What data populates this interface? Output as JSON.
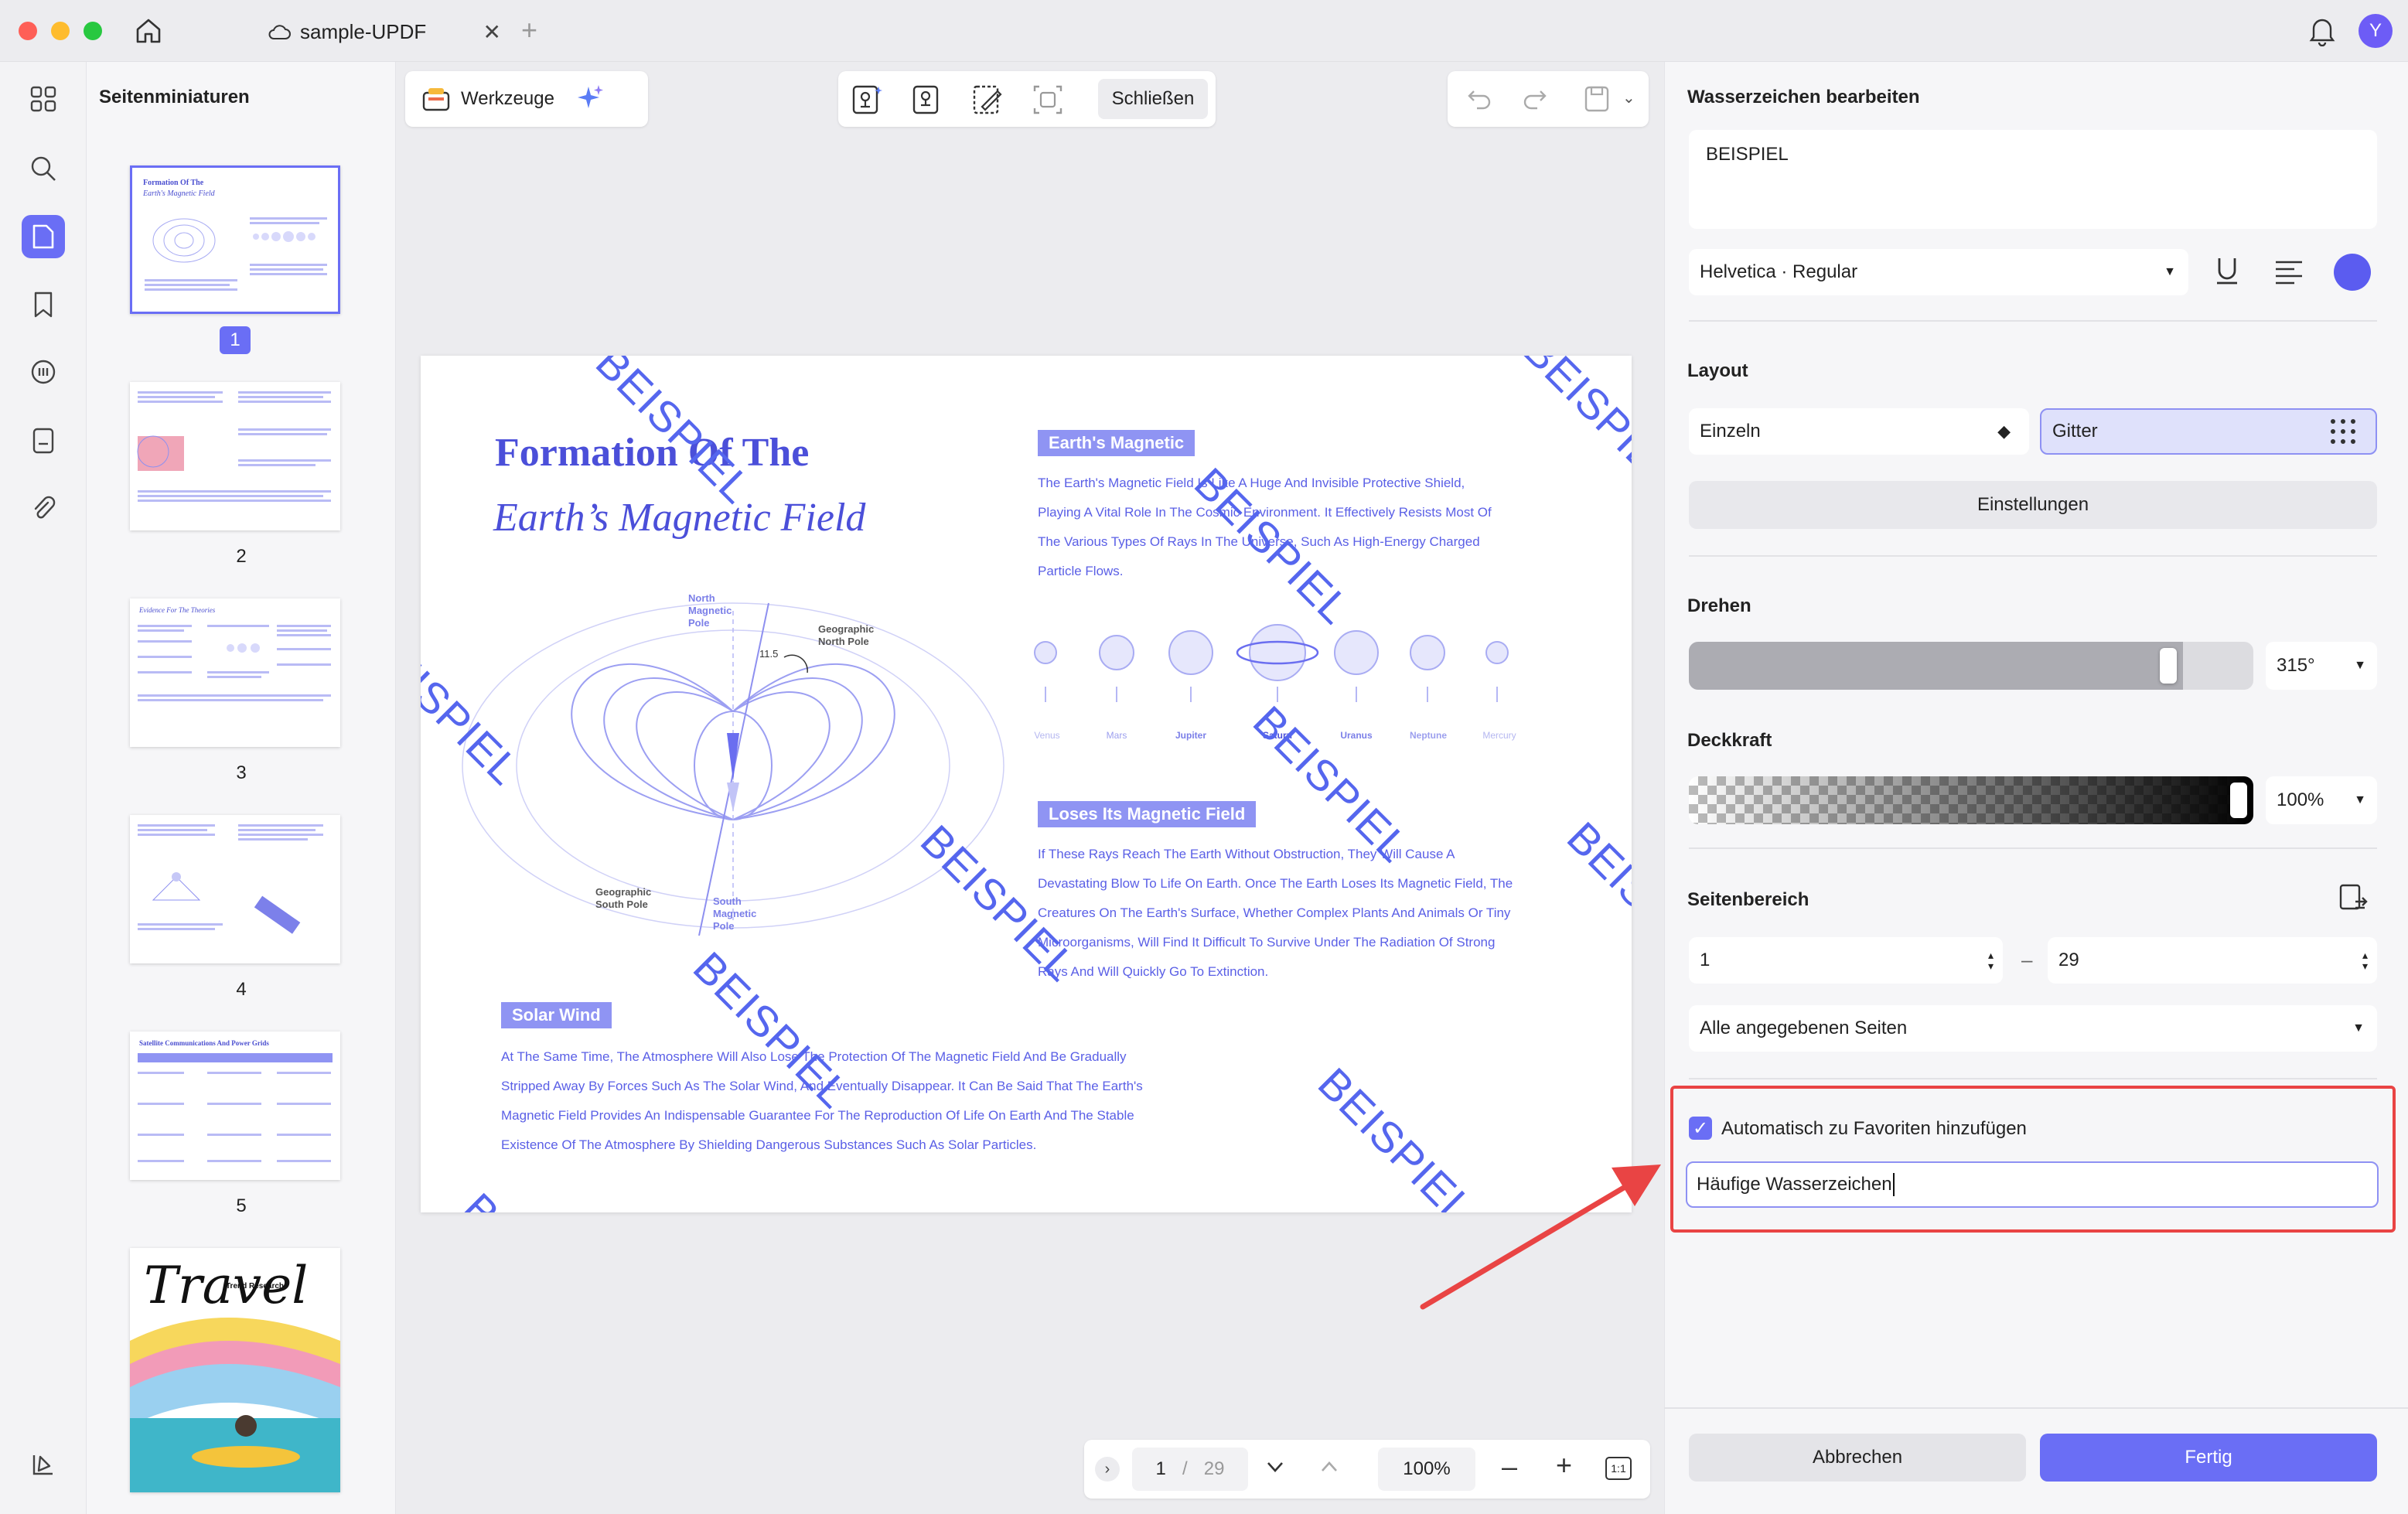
{
  "titlebar": {
    "tab_title": "sample-UPDF",
    "avatar_letter": "Y",
    "traffic_colors": [
      "#fe5f57",
      "#febc2e",
      "#28c840"
    ]
  },
  "thumbnails": {
    "title": "Seitenminiaturen",
    "pages": [
      {
        "num": "1",
        "title": "Formation Of The",
        "subtitle": "Earth's Magnetic Field"
      },
      {
        "num": "2"
      },
      {
        "num": "3",
        "title": "Evidence For The Theories"
      },
      {
        "num": "4"
      },
      {
        "num": "5",
        "title": "Satellite Communications And Power Grids"
      },
      {
        "num": "",
        "title": "Travel",
        "subtitle": "Trend Research"
      }
    ]
  },
  "toolbar": {
    "tools_label": "Werkzeuge",
    "close_label": "Schließen"
  },
  "document": {
    "watermark": "BEISPIEL",
    "title1": "Formation Of The",
    "title2": "Earth’s Magnetic Field",
    "section1_head": "Earth's Magnetic",
    "section1_body": "The Earth's Magnetic Field Is Like A Huge And Invisible Protective Shield, Playing A Vital Role In The Cosmic Environment. It Effectively Resists Most Of The Various Types Of Rays In The Universe, Such As High-Energy Charged Particle Flows.",
    "section2_head": "Loses Its Magnetic Field",
    "section2_body": "If These Rays Reach The Earth Without Obstruction, They Will Cause A Devastating Blow To Life On Earth. Once The Earth Loses Its Magnetic Field, The Creatures On The Earth's Surface, Whether Complex Plants And Animals Or Tiny Microorganisms, Will Find It Difficult To Survive Under The Radiation Of Strong Rays And Will Quickly Go To Extinction.",
    "section3_head": "Solar Wind",
    "section3_body": "At The Same Time, The Atmosphere Will Also Lose The Protection Of The Magnetic Field And Be Gradually Stripped Away By Forces Such As The Solar Wind, And Eventually Disappear. It Can Be Said That The Earth's Magnetic Field Provides An Indispensable Guarantee For The Reproduction Of Life On Earth And The Stable Existence Of The Atmosphere By Shielding Dangerous Substances Such As Solar Particles.",
    "diagram_labels": {
      "north_magnetic": "North Magnetic Pole",
      "geographic_north": "Geographic North Pole",
      "geographic_south": "Geographic South Pole",
      "south_magnetic": "South Magnetic Pole",
      "angle": "11.5"
    },
    "planets": [
      "Venus",
      "Mars",
      "Jupiter",
      "Saturn",
      "Uranus",
      "Neptune",
      "Mercury"
    ]
  },
  "pager": {
    "current": "1",
    "separator": "/",
    "total": "29",
    "zoom": "100%",
    "fit": "1:1"
  },
  "panel": {
    "title": "Wasserzeichen bearbeiten",
    "watermark_text": "BEISPIEL",
    "font": "Helvetica · Regular",
    "text_color": "#5b5cf0",
    "layout_label": "Layout",
    "layout_single": "Einzeln",
    "layout_grid": "Gitter",
    "settings_button": "Einstellungen",
    "rotate_label": "Drehen",
    "rotate_value": "315°",
    "rotate_fraction": 0.875,
    "opacity_label": "Deckkraft",
    "opacity_value": "100%",
    "range_label": "Seitenbereich",
    "range_from": "1",
    "range_dash": "–",
    "range_to": "29",
    "pages_select": "Alle angegebenen Seiten",
    "favorites_checkbox": "Automatisch zu Favoriten hinzufügen",
    "favorites_checked": true,
    "favorites_name": "Häufige Wasserzeichen",
    "cancel_button": "Abbrechen",
    "done_button": "Fertig",
    "accent": "#6a6ef5",
    "highlight_color": "#e94444"
  }
}
